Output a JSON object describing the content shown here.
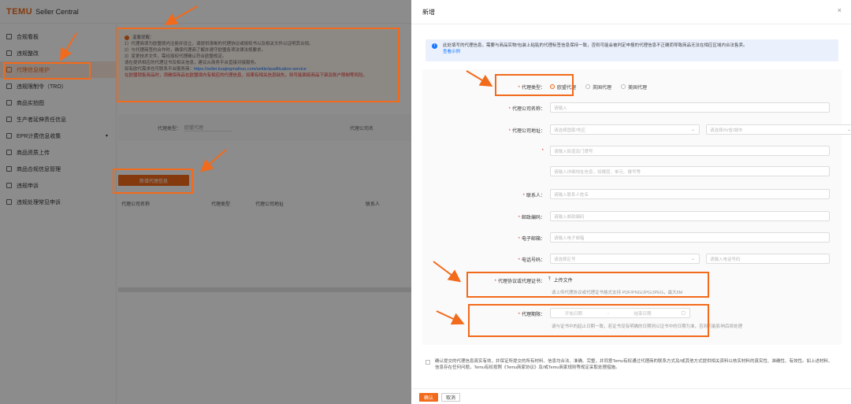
{
  "app": {
    "logo": "TEMU",
    "logo_sub": "Seller Central"
  },
  "sidebar": {
    "items": [
      {
        "label": "合规看板"
      },
      {
        "label": "违规整改"
      },
      {
        "label": "代理信息维护"
      },
      {
        "label": "违规限制令（TRO）"
      },
      {
        "label": "商品实拍图"
      },
      {
        "label": "生产者延伸责任信息"
      },
      {
        "label": "EPR计费信息收集"
      },
      {
        "label": "商品资质上传"
      },
      {
        "label": "商品合规信息管理"
      },
      {
        "label": "违规申诉"
      },
      {
        "label": "违规处理常见申诉"
      }
    ]
  },
  "notice": {
    "title": "温馨提醒：",
    "line1": "1）代理商须为欧盟境内注册并设立，请提供清晰的代理协议或授权书以及相关文件以证明其合规。",
    "line2": "2）与代理商签约合作时，确保代理商了解并遵守欧盟各项法律法规要求。",
    "line3": "3）变更技术文件，需经授权代理确认符合欧盟规定。",
    "line4": "请在提供相应的代理证书及相关信息，建议从商务平台直接对接服务。",
    "line5_prefix": "如有欧代需求也可联系平台服务商：",
    "line5_link": "https://seller.kuajingmaihuo.com/settle/qualification-service",
    "line6": "在欧盟销售商品时，须确保商品在欧盟境内有相应的代理信息，如果有相关信息缺失，则可能面临商品下架及账户限制等风险。"
  },
  "filter": {
    "label": "代理类型：",
    "value": "欧盟代理",
    "label2": "代理公司名"
  },
  "add_button": "新增代理信息",
  "table": {
    "headers": [
      "代理公司名称",
      "代理类型",
      "代理公司地址",
      "联系人"
    ]
  },
  "drawer": {
    "title": "新增",
    "close": "×",
    "info_text": "此处填写的代理信息，需要与商品实物/包装上粘贴的代理标签信息保持一致，否则可能会被判定申报的代理信息不正确而导致商品无法在相应区域内合法售卖。",
    "info_link": "查看示例",
    "agent_type": {
      "label": "代理类型：",
      "options": [
        "欧盟代理",
        "英国代理",
        "美国代理"
      ],
      "selected": 0
    },
    "company_name": {
      "label": "代理公司名称：",
      "placeholder": "请输入"
    },
    "company_address": {
      "label": "代理公司地址：",
      "country_placeholder": "请选择国家/地区",
      "region_placeholder": "请选择州/省/城市",
      "street_placeholder": "请输入街道及门牌号",
      "detail_placeholder": "请输入详细地址信息，如楼层、单元、楼号等"
    },
    "contact": {
      "label": "联系人：",
      "placeholder": "请输入联系人姓名"
    },
    "postcode": {
      "label": "邮政编码：",
      "placeholder": "请输入邮政编码"
    },
    "email": {
      "label": "电子邮箱：",
      "placeholder": "请输入电子邮箱"
    },
    "phone": {
      "label": "电话号码：",
      "code_placeholder": "请选择区号",
      "number_placeholder": "请输入电话号码"
    },
    "certificate": {
      "label": "代理协议或代理证书：",
      "upload": "上传文件",
      "hint": "请上传代理协议或代理证书格式支持 PDF/PNG/JPG/JPEG，最大5M"
    },
    "validity": {
      "label": "代理期限：",
      "start_placeholder": "开始日期",
      "end_placeholder": "结束日期",
      "hint": "请与证书中的起止日期一致，若证书没有明确的日期则以证书中的日期为准，否则可能影响后续处理"
    },
    "confirm_text": "确认提交的代理信息真实有效，并保证所提交的所有材料、信息均合法、准确、完整，并同意Temu有权通过代理商的联系方式及/或其他方式提供相关资料以核实材料的真实性、准确性、有效性。如上述材料、信息存在任何问题，Temu有权按照《Temu商家协议》及/或Temu商家规则等规定采取处理措施。",
    "ok": "确认",
    "cancel": "取消"
  },
  "colors": {
    "brand": "#f26a1b",
    "annotation": "#f26a1b",
    "info_bg": "#eaf1fd",
    "link": "#1677ff"
  }
}
